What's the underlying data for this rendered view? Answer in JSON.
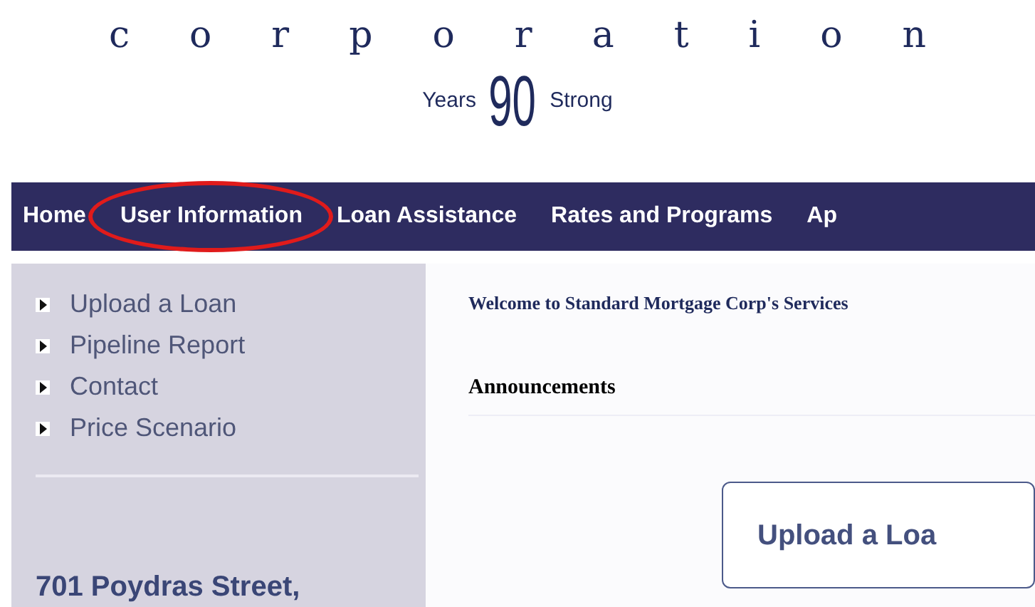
{
  "logo": {
    "wordmark": "corporation",
    "tagline_left": "Years",
    "number": "90",
    "tagline_right": "Strong"
  },
  "nav": [
    {
      "label": "Home",
      "highlighted": false
    },
    {
      "label": "User Information",
      "highlighted": true
    },
    {
      "label": "Loan Assistance",
      "highlighted": false
    },
    {
      "label": "Rates and Programs",
      "highlighted": false
    },
    {
      "label": "Ap",
      "highlighted": false
    }
  ],
  "sidebar": {
    "items": [
      "Upload a Loan",
      "Pipeline Report",
      "Contact",
      "Price Scenario"
    ],
    "address": "701 Poydras Street,"
  },
  "content": {
    "welcome": "Welcome to Standard Mortgage Corp's Services",
    "heading": "Announcements",
    "button": "Upload a Loa"
  }
}
